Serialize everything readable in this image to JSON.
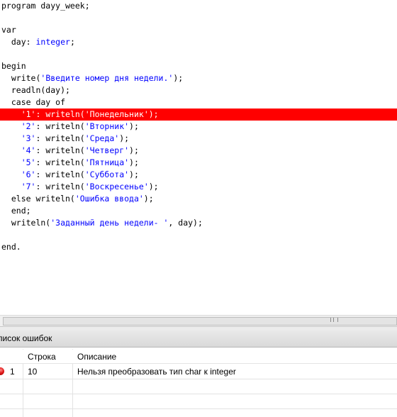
{
  "editor": {
    "lines": [
      "program dayy_week;",
      "",
      "var",
      "  day: integer;",
      "",
      "begin",
      "  write('Введите номер дня недели.');",
      "  readln(day);",
      "  case day of",
      "    '1': writeln('Понедельник');",
      "    '2': writeln('Вторник');",
      "    '3': writeln('Среда');",
      "    '4': writeln('Четверг');",
      "    '5': writeln('Пятница');",
      "    '6': writeln('Суббота');",
      "    '7': writeln('Воскресенье');",
      "  else writeln('Ошибка ввода');",
      "  end;",
      "  writeln('Заданный день недели- ', day);",
      "",
      "end."
    ],
    "highlighted_line": 10,
    "colors": {
      "highlight": "#ff0000",
      "string": "#0000ff",
      "type": "#0000ff"
    }
  },
  "errors_panel": {
    "title": "писок ошибок",
    "columns": {
      "line": "Строка",
      "description": "Описание"
    },
    "rows": [
      {
        "index": "1",
        "line": "10",
        "description": "Нельзя преобразовать тип char к integer",
        "icon": "error-icon"
      }
    ]
  }
}
